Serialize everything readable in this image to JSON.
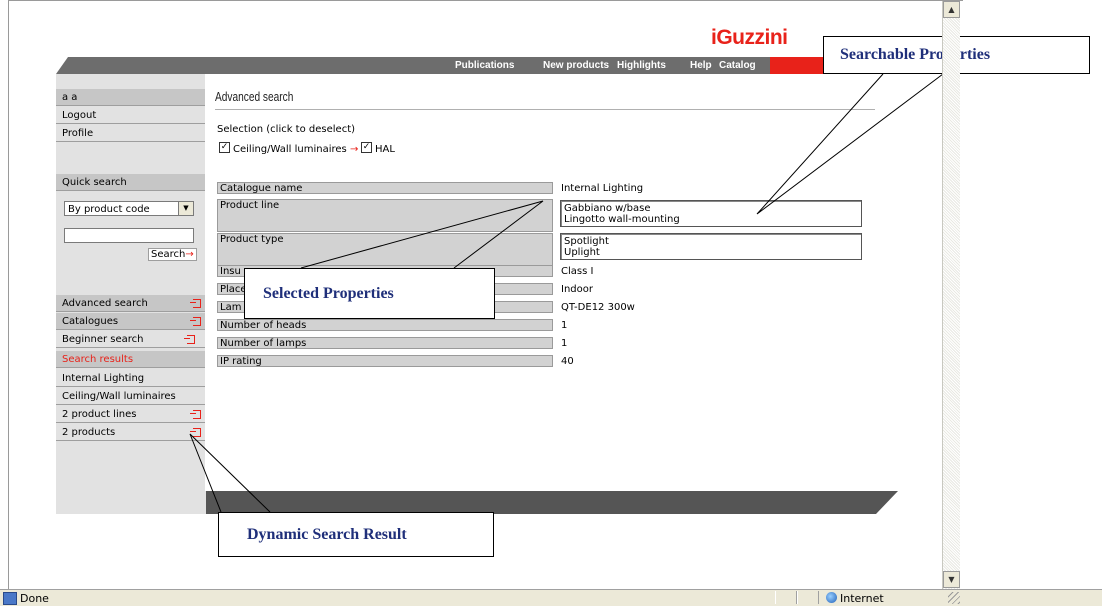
{
  "browser": {
    "status_text": "Done",
    "zone_text": "Internet"
  },
  "logo_text": "iGuzzini",
  "topnav": [
    "Publications",
    "New products",
    "Highlights",
    "Help",
    "Catalog"
  ],
  "sidebar": {
    "user": "a a",
    "logout": "Logout",
    "profile": "Profile",
    "quick_search": "Quick search",
    "select_value": "By product code",
    "search_button": "Search",
    "nav": [
      "Advanced search",
      "Catalogues",
      "Beginner search",
      "Search results",
      "Internal Lighting",
      "Ceiling/Wall luminaires",
      "2 product lines",
      "2 products"
    ]
  },
  "main": {
    "title": "Advanced search",
    "selection_label": "Selection (click to deselect)",
    "selection": [
      "Ceiling/Wall luminaires",
      "HAL"
    ],
    "properties": [
      {
        "label": "Catalogue name",
        "value": "Internal Lighting"
      },
      {
        "label": "Product line",
        "values": [
          "Gabbiano w/base",
          "Lingotto wall-mounting"
        ]
      },
      {
        "label": "Product type",
        "values": [
          "Spotlight",
          "Uplight"
        ]
      },
      {
        "label": "Insu",
        "value": "Class I"
      },
      {
        "label": "Place",
        "value": "Indoor"
      },
      {
        "label": "Lam",
        "value": "QT-DE12 300w"
      },
      {
        "label": "Number of heads",
        "value": "1"
      },
      {
        "label": "Number of lamps",
        "value": "1"
      },
      {
        "label": "IP rating",
        "value": "40"
      }
    ]
  },
  "callouts": {
    "searchable": "Searchable Properties",
    "selected": "Selected Properties",
    "dynamic": "Dynamic Search Result"
  }
}
